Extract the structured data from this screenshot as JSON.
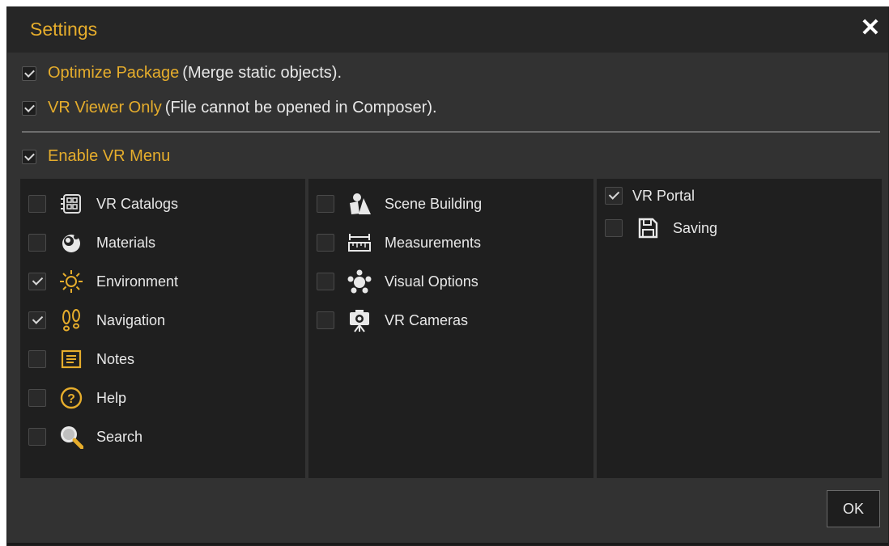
{
  "dialog": {
    "title": "Settings",
    "close_glyph": "✕",
    "ok_label": "OK"
  },
  "options": {
    "optimize": {
      "label": "Optimize Package",
      "note": "(Merge static objects).",
      "checked": true
    },
    "vr_viewer": {
      "label": "VR Viewer Only",
      "note": "(File cannot be opened in Composer).",
      "checked": true
    },
    "enable_menu": {
      "label": "Enable VR Menu",
      "checked": true
    }
  },
  "columns": [
    {
      "items": [
        {
          "label": "VR Catalogs",
          "checked": false,
          "icon": "catalog-icon"
        },
        {
          "label": "Materials",
          "checked": false,
          "icon": "materials-icon"
        },
        {
          "label": "Environment",
          "checked": true,
          "icon": "sun-icon"
        },
        {
          "label": "Navigation",
          "checked": true,
          "icon": "footprints-icon"
        },
        {
          "label": "Notes",
          "checked": false,
          "icon": "notes-icon"
        },
        {
          "label": "Help",
          "checked": false,
          "icon": "help-icon"
        },
        {
          "label": "Search",
          "checked": false,
          "icon": "search-icon"
        }
      ]
    },
    {
      "items": [
        {
          "label": "Scene Building",
          "checked": false,
          "icon": "shapes-icon"
        },
        {
          "label": "Measurements",
          "checked": false,
          "icon": "ruler-icon"
        },
        {
          "label": "Visual Options",
          "checked": false,
          "icon": "visual-options-icon"
        },
        {
          "label": "VR Cameras",
          "checked": false,
          "icon": "camera-icon"
        }
      ]
    },
    {
      "items": [
        {
          "label": "VR Portal",
          "checked": true,
          "icon": ""
        },
        {
          "label": "Saving",
          "checked": false,
          "icon": "save-icon"
        }
      ]
    }
  ],
  "colors": {
    "accent": "#e6ad2c",
    "dialog_bg": "#323232",
    "panel_bg": "#1f1f1f",
    "text": "#e8e8e8"
  }
}
